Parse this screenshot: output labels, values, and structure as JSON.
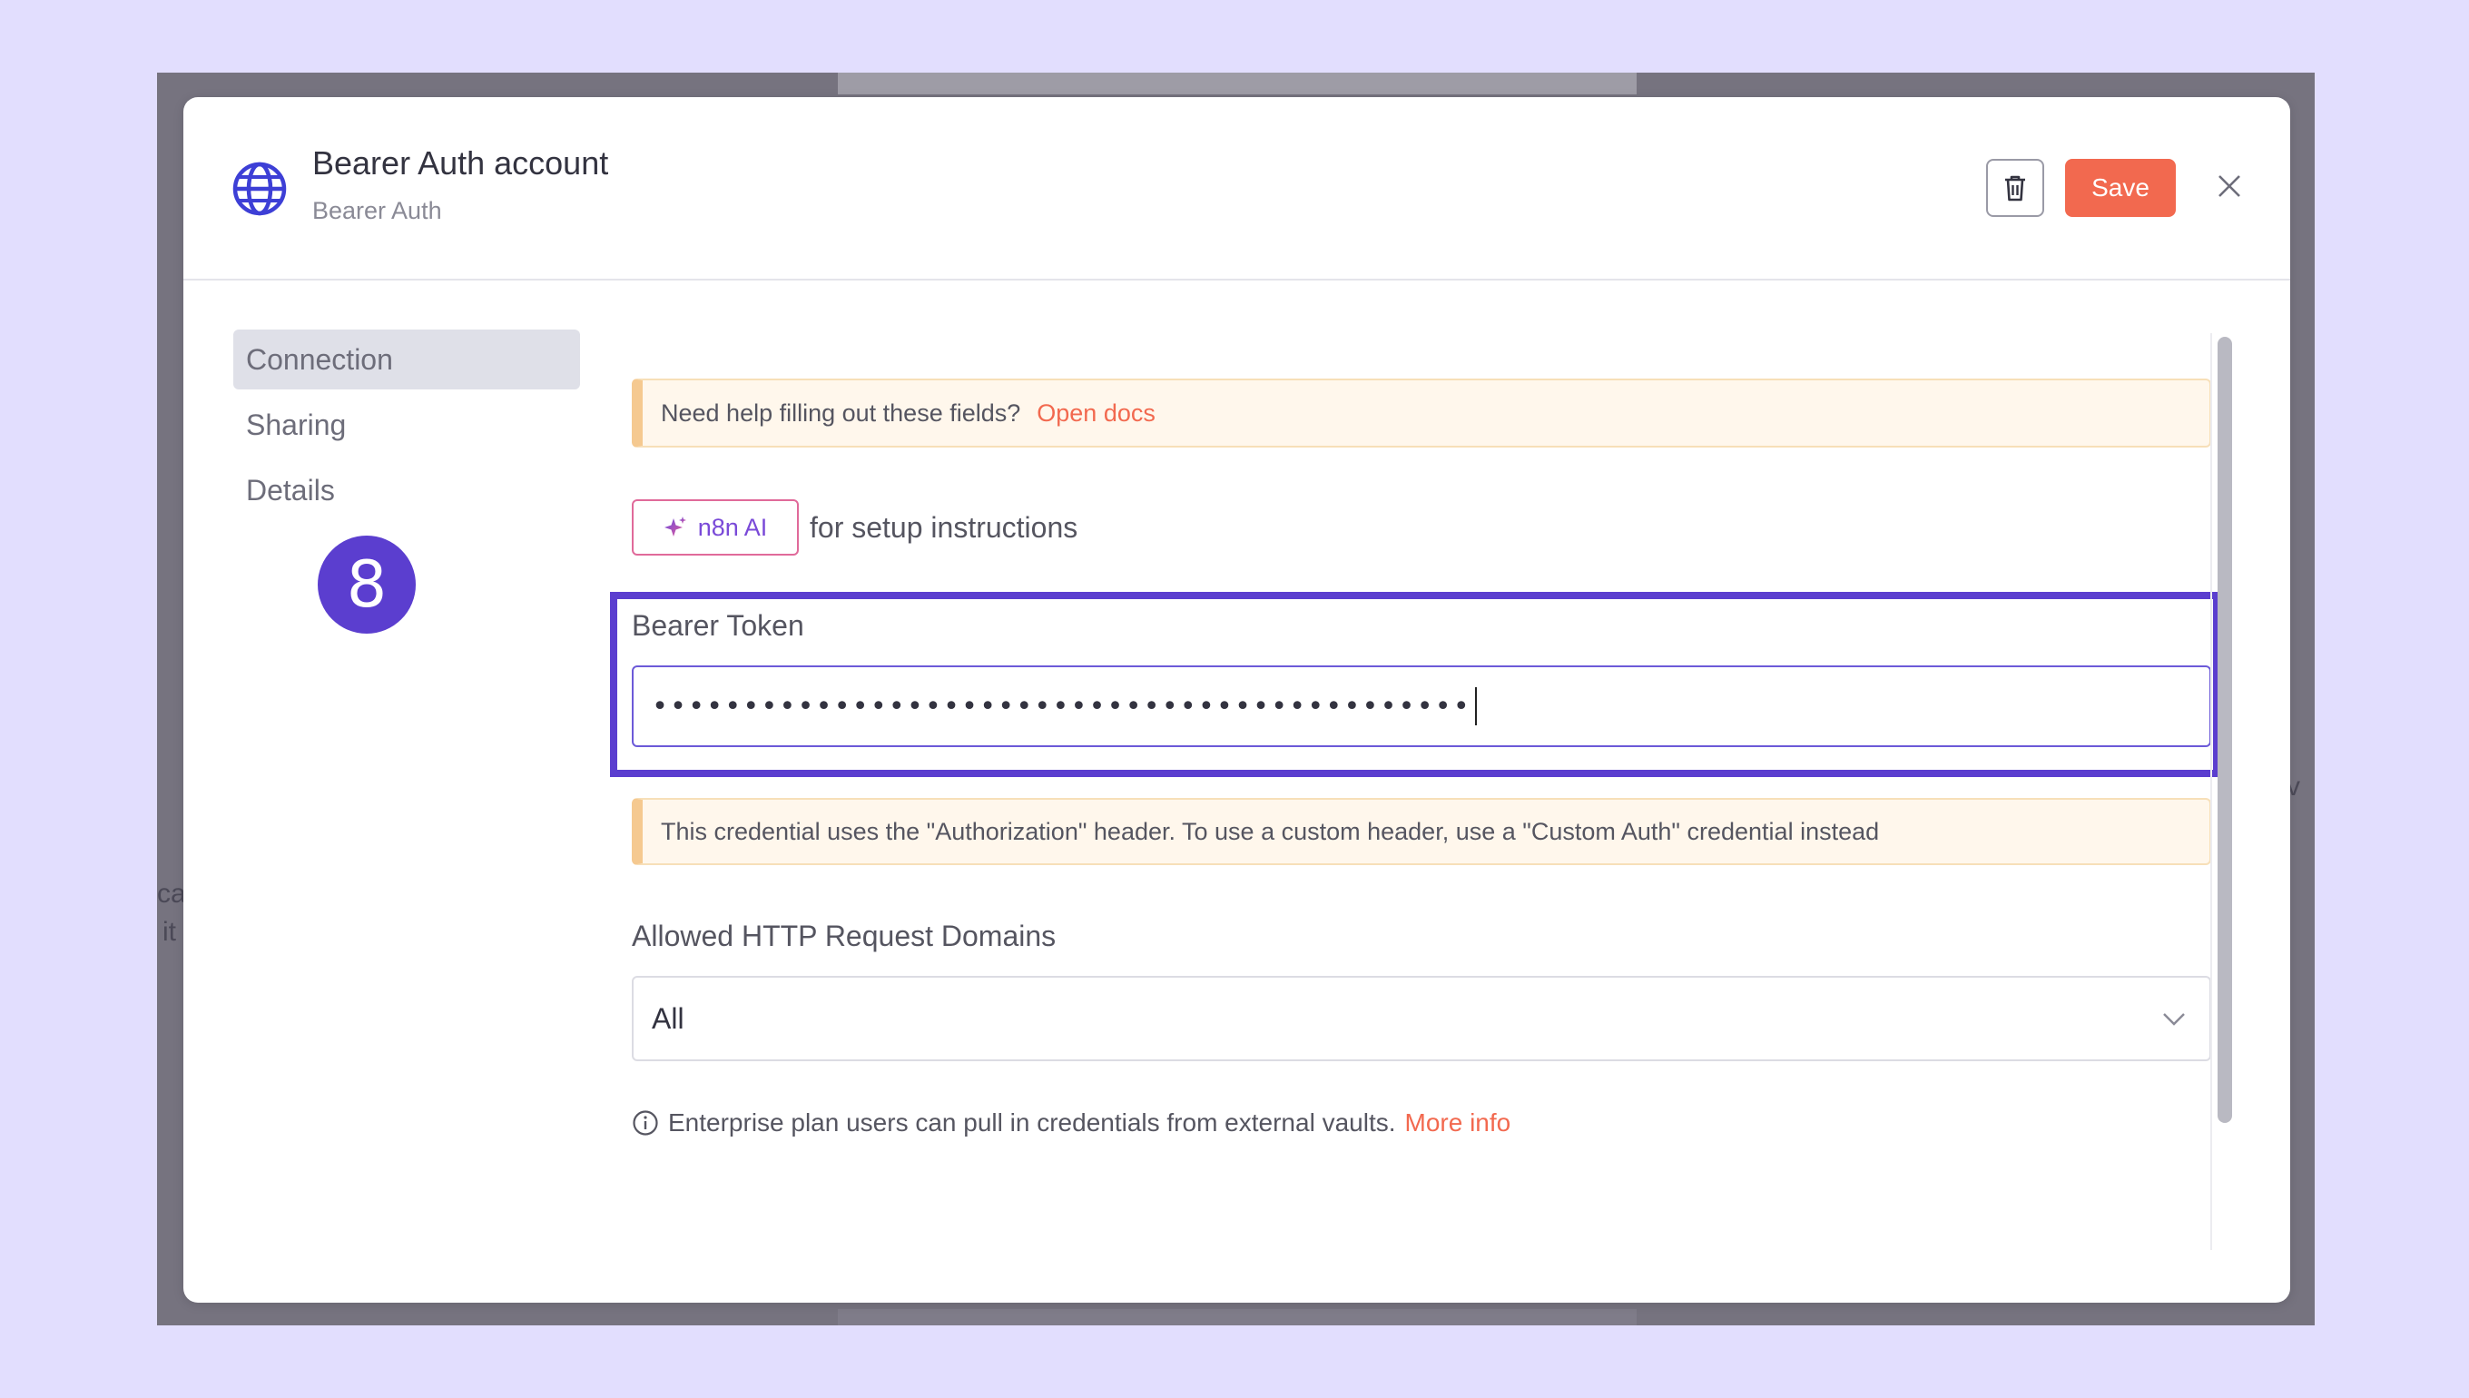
{
  "colors": {
    "accent": "#f2694f",
    "highlight": "#5b3ecf",
    "callout_border": "#f5c990",
    "page_background": "#e2defe"
  },
  "backdrop": {
    "fragments": [
      "ca",
      "it",
      "v"
    ]
  },
  "header": {
    "icon": "globe-icon",
    "title": "Bearer Auth account",
    "subtitle": "Bearer Auth",
    "save_label": "Save",
    "delete_icon": "trash-icon",
    "close_icon": "close-icon"
  },
  "sidebar": {
    "items": [
      {
        "label": "Connection",
        "active": true
      },
      {
        "label": "Sharing",
        "active": false
      },
      {
        "label": "Details",
        "active": false
      }
    ]
  },
  "main": {
    "help_callout": {
      "text": "Need help filling out these fields?",
      "link": "Open docs"
    },
    "ai_button": {
      "label": "n8n AI",
      "icon": "sparkle-icon",
      "suffix_text": "for setup instructions"
    },
    "bearer_token": {
      "label": "Bearer Token",
      "value": "•••••••••••••••••••••••••••••••••••••••••••••"
    },
    "step_badge": "8",
    "header_callout": {
      "text": "This credential uses the \"Authorization\" header. To use a custom header, use a \"Custom Auth\" credential instead"
    },
    "allowed_domains": {
      "label": "Allowed HTTP Request Domains",
      "selected": "All",
      "icon": "chevron-down-icon"
    },
    "enterprise_note": {
      "icon": "info-icon",
      "text": "Enterprise plan users can pull in credentials from external vaults.",
      "link": "More info"
    }
  }
}
